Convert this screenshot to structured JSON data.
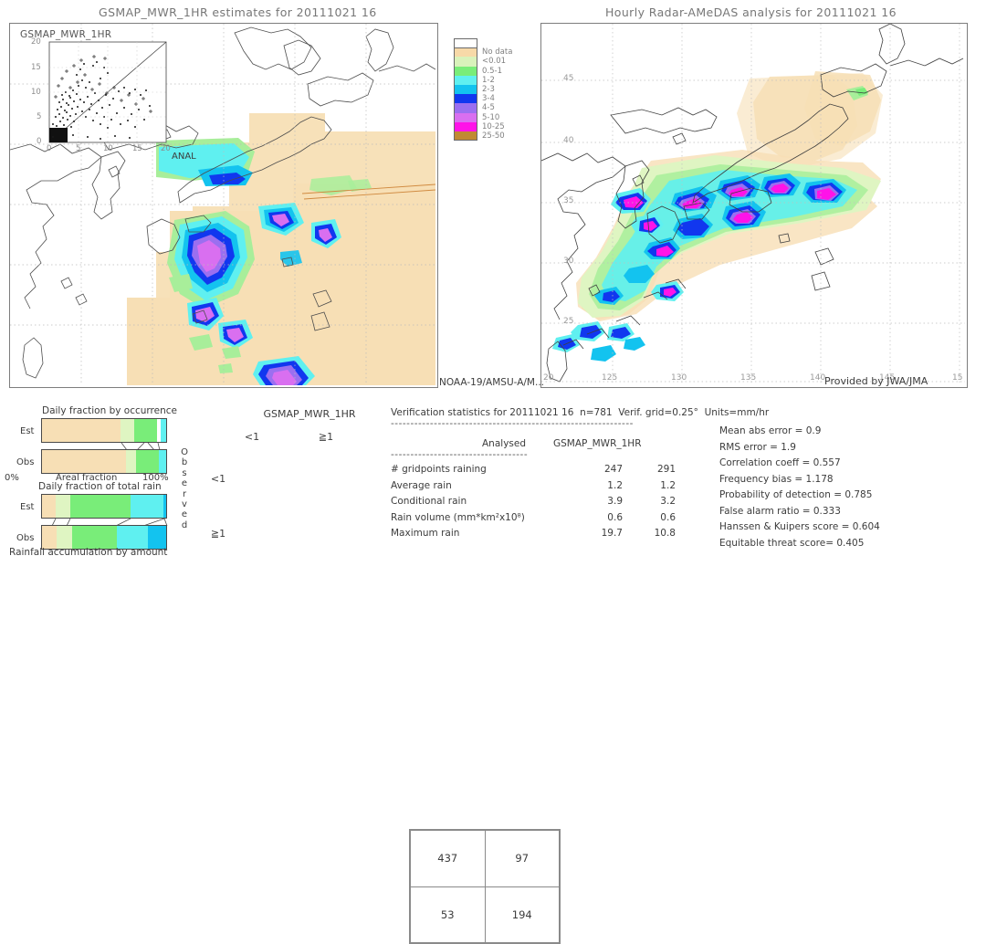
{
  "panels": {
    "left_title": "GSMAP_MWR_1HR estimates for 20111021 16",
    "right_title": "Hourly Radar-AMeDAS analysis for 20111021 16",
    "left_inset_title": "GSMAP_MWR_1HR",
    "left_anal_label": "ANAL",
    "left_footer": "NOAA-19/AMSU-A/M...",
    "right_footer": "Provided by JWA/JMA"
  },
  "legend": {
    "title": "",
    "entries": [
      {
        "label": "No data",
        "color": "#f7d9a8"
      },
      {
        "label": "<0.01",
        "color": "#d9f2bb"
      },
      {
        "label": "0.5-1",
        "color": "#79ed79"
      },
      {
        "label": "1-2",
        "color": "#5ff0f0"
      },
      {
        "label": "2-3",
        "color": "#13c3ef"
      },
      {
        "label": "3-4",
        "color": "#1137ef"
      },
      {
        "label": "4-5",
        "color": "#9b6ff0"
      },
      {
        "label": "5-10",
        "color": "#d96ff0"
      },
      {
        "label": "10-25",
        "color": "#ff13e8"
      },
      {
        "label": "25-50",
        "color": "#c18a33"
      }
    ]
  },
  "scatter": {
    "axis_ticks_y": [
      "20",
      "15",
      "10",
      "5",
      "0"
    ],
    "axis_ticks_x": [
      "0",
      "5",
      "10",
      "15",
      "20"
    ],
    "xlabel": "",
    "ylabel": ""
  },
  "maps": {
    "left": {
      "lon_ticks": [],
      "lat_ticks": []
    },
    "right": {
      "lon_ticks": [
        "125",
        "130",
        "135",
        "140",
        "145",
        "15"
      ],
      "lat_ticks": [
        "45",
        "40",
        "35",
        "30",
        "25",
        "20"
      ]
    }
  },
  "fraction_charts": [
    {
      "title": "Daily fraction by occurrence",
      "axis_left": "0%",
      "axis_center": "Areal fraction",
      "axis_right": "100%",
      "rows": [
        {
          "label": "Est",
          "segments": [
            {
              "color": "#f7dfb5",
              "pct": 63.5
            },
            {
              "color": "#dff5c2",
              "pct": 11.0
            },
            {
              "color": "#79ed79",
              "pct": 18.5
            },
            {
              "color": "#ffffff",
              "pct": 2.5
            },
            {
              "color": "#5ff0f0",
              "pct": 4.5
            }
          ]
        },
        {
          "label": "Obs",
          "segments": [
            {
              "color": "#f7dfb5",
              "pct": 68.0
            },
            {
              "color": "#dff5c2",
              "pct": 8.0
            },
            {
              "color": "#79ed79",
              "pct": 18.0
            },
            {
              "color": "#5ff0f0",
              "pct": 6.0
            }
          ]
        }
      ]
    },
    {
      "title": "Daily fraction of total rain",
      "caption": "Rainfall accumulation by amount",
      "rows": [
        {
          "label": "Est",
          "segments": [
            {
              "color": "#f7dfb5",
              "pct": 11.0
            },
            {
              "color": "#dff5c2",
              "pct": 12.0
            },
            {
              "color": "#79ed79",
              "pct": 48.0
            },
            {
              "color": "#5ff0f0",
              "pct": 27.0
            },
            {
              "color": "#13c3ef",
              "pct": 2.0
            }
          ]
        },
        {
          "label": "Obs",
          "segments": [
            {
              "color": "#f7dfb5",
              "pct": 12.0
            },
            {
              "color": "#dff5c2",
              "pct": 12.0
            },
            {
              "color": "#79ed79",
              "pct": 36.0
            },
            {
              "color": "#5ff0f0",
              "pct": 25.0
            },
            {
              "color": "#13c3ef",
              "pct": 15.0
            }
          ]
        }
      ]
    }
  ],
  "contingency": {
    "title": "GSMAP_MWR_1HR",
    "col_headers": [
      "<1",
      "≧1"
    ],
    "row_headers": [
      "<1",
      "≧1"
    ],
    "axis_label": "Observed",
    "cells": [
      [
        "437",
        "97"
      ],
      [
        "53",
        "194"
      ]
    ]
  },
  "verification": {
    "header": "Verification statistics for 20111021 16  n=781  Verif. grid=0.25°  Units=mm/hr",
    "rule": "--------------------------------------------------------------",
    "col_head_analysed": "Analysed",
    "col_head_model": "GSMAP_MWR_1HR",
    "subrule": "-----------------------------------",
    "rows": [
      {
        "name": "# gridpoints raining",
        "analysed": "247",
        "model": "291"
      },
      {
        "name": "Average rain",
        "analysed": "1.2",
        "model": "1.2"
      },
      {
        "name": "Conditional rain",
        "analysed": "3.9",
        "model": "3.2"
      },
      {
        "name": "Rain volume (mm*km²x10⁸)",
        "analysed": "0.6",
        "model": "0.6"
      },
      {
        "name": "Maximum rain",
        "analysed": "19.7",
        "model": "10.8"
      }
    ],
    "scores": [
      {
        "label": "Mean abs error = 0.9"
      },
      {
        "label": "RMS error = 1.9"
      },
      {
        "label": "Correlation coeff = 0.557"
      },
      {
        "label": "Frequency bias = 1.178"
      },
      {
        "label": "Probability of detection = 0.785"
      },
      {
        "label": "False alarm ratio = 0.333"
      },
      {
        "label": "Hanssen & Kuipers score = 0.604"
      },
      {
        "label": "Equitable threat score= 0.405"
      }
    ]
  }
}
